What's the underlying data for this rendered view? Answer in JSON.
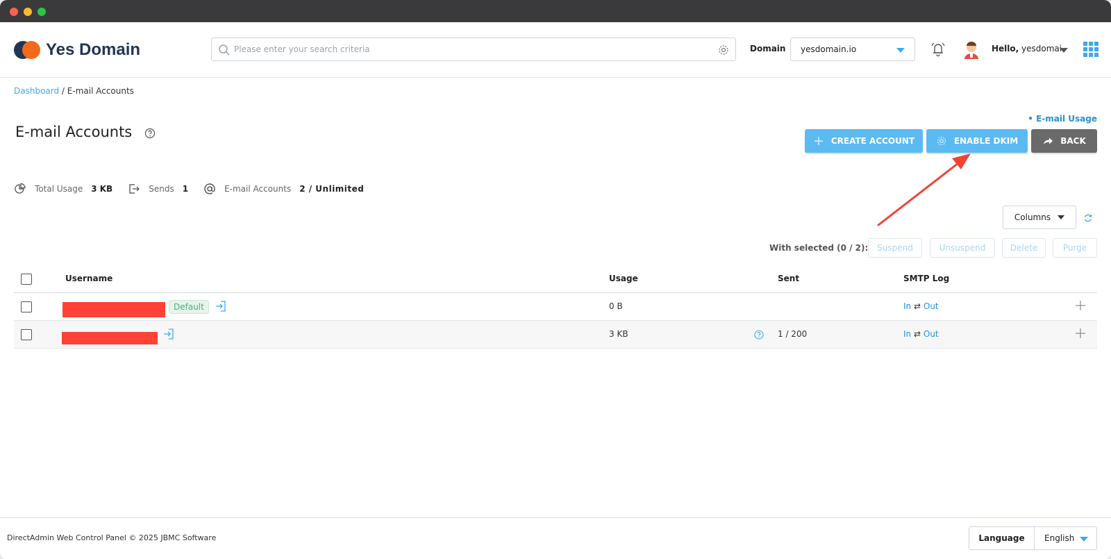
{
  "brand": {
    "name": "Yes Domain"
  },
  "search": {
    "placeholder": "Please enter your search criteria"
  },
  "domain": {
    "label": "Domain",
    "selected": "yesdomain.io"
  },
  "user": {
    "hello": "Hello,",
    "name": "yesdomai"
  },
  "breadcrumb": {
    "home": "Dashboard",
    "separator": " / ",
    "current": "E-mail Accounts"
  },
  "email_usage_link": "• E-mail Usage",
  "page": {
    "title": "E-mail Accounts"
  },
  "actions": {
    "create": "CREATE ACCOUNT",
    "dkim": "ENABLE DKIM",
    "back": "BACK"
  },
  "stats": {
    "total_usage": {
      "label": "Total Usage",
      "value": "3 KB"
    },
    "sends": {
      "label": "Sends",
      "value": "1"
    },
    "accounts": {
      "label": "E-mail Accounts",
      "value": "2 / Unlimited"
    }
  },
  "columns_button": "Columns",
  "with_selected": {
    "label": "With selected (0 / 2):",
    "suspend": "Suspend",
    "unsuspend": "Unsuspend",
    "delete": "Delete",
    "purge": "Purge"
  },
  "table": {
    "headers": {
      "username": "Username",
      "usage": "Usage",
      "sent": "Sent",
      "smtp_log": "SMTP Log"
    },
    "rows": [
      {
        "badge": "Default",
        "usage": "0 B",
        "sent": "",
        "log_in": "In",
        "log_sep": "⇄",
        "log_out": "Out"
      },
      {
        "usage": "3 KB",
        "sent": "1 / 200",
        "log_in": "In",
        "log_sep": "⇄",
        "log_out": "Out"
      }
    ]
  },
  "footer": {
    "copyright": "DirectAdmin Web Control Panel © 2025 JBMC Software",
    "language_label": "Language",
    "language_value": "English"
  },
  "colors": {
    "accent": "#3da9f0",
    "button": "#5bbaf2",
    "back_button": "#6a6a6a",
    "brand_dark": "#223651",
    "brand_orange": "#f36a1b",
    "annotation": "#f04437"
  }
}
